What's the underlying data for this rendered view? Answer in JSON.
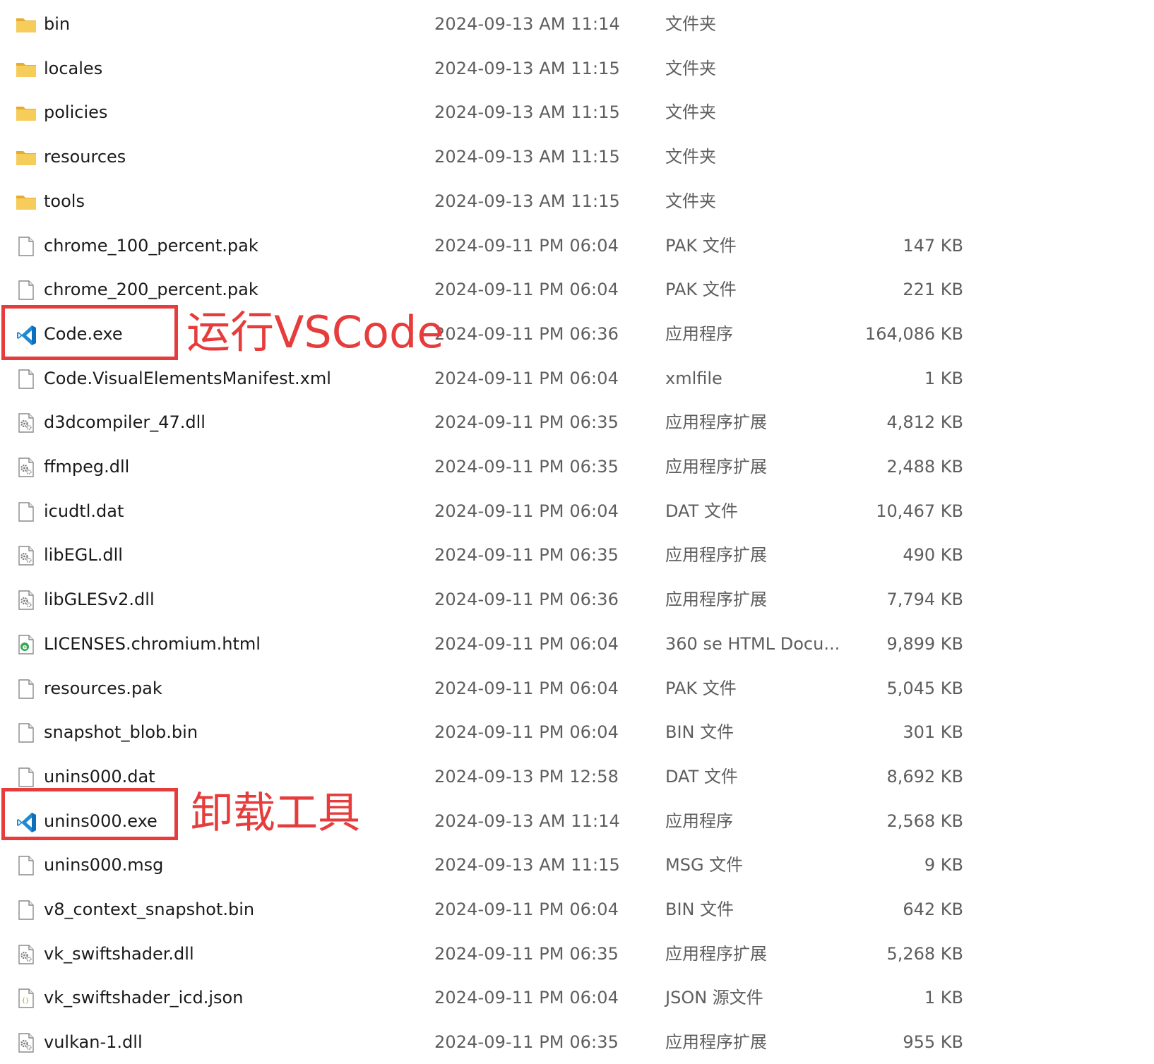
{
  "files": [
    {
      "name": "bin",
      "date": "2024-09-13 AM 11:14",
      "type": "文件夹",
      "size": "",
      "icon": "folder-icon"
    },
    {
      "name": "locales",
      "date": "2024-09-13 AM 11:15",
      "type": "文件夹",
      "size": "",
      "icon": "folder-icon"
    },
    {
      "name": "policies",
      "date": "2024-09-13 AM 11:15",
      "type": "文件夹",
      "size": "",
      "icon": "folder-icon"
    },
    {
      "name": "resources",
      "date": "2024-09-13 AM 11:15",
      "type": "文件夹",
      "size": "",
      "icon": "folder-icon"
    },
    {
      "name": "tools",
      "date": "2024-09-13 AM 11:15",
      "type": "文件夹",
      "size": "",
      "icon": "folder-icon"
    },
    {
      "name": "chrome_100_percent.pak",
      "date": "2024-09-11 PM 06:04",
      "type": "PAK 文件",
      "size": "147 KB",
      "icon": "file-icon"
    },
    {
      "name": "chrome_200_percent.pak",
      "date": "2024-09-11 PM 06:04",
      "type": "PAK 文件",
      "size": "221 KB",
      "icon": "file-icon"
    },
    {
      "name": "Code.exe",
      "date": "2024-09-11 PM 06:36",
      "type": "应用程序",
      "size": "164,086 KB",
      "icon": "vscode-icon"
    },
    {
      "name": "Code.VisualElementsManifest.xml",
      "date": "2024-09-11 PM 06:04",
      "type": "xmlfile",
      "size": "1 KB",
      "icon": "file-icon"
    },
    {
      "name": "d3dcompiler_47.dll",
      "date": "2024-09-11 PM 06:35",
      "type": "应用程序扩展",
      "size": "4,812 KB",
      "icon": "dll-icon"
    },
    {
      "name": "ffmpeg.dll",
      "date": "2024-09-11 PM 06:35",
      "type": "应用程序扩展",
      "size": "2,488 KB",
      "icon": "dll-icon"
    },
    {
      "name": "icudtl.dat",
      "date": "2024-09-11 PM 06:04",
      "type": "DAT 文件",
      "size": "10,467 KB",
      "icon": "file-icon"
    },
    {
      "name": "libEGL.dll",
      "date": "2024-09-11 PM 06:35",
      "type": "应用程序扩展",
      "size": "490 KB",
      "icon": "dll-icon"
    },
    {
      "name": "libGLESv2.dll",
      "date": "2024-09-11 PM 06:36",
      "type": "应用程序扩展",
      "size": "7,794 KB",
      "icon": "dll-icon"
    },
    {
      "name": "LICENSES.chromium.html",
      "date": "2024-09-11 PM 06:04",
      "type": "360 se HTML Docu...",
      "size": "9,899 KB",
      "icon": "html-icon"
    },
    {
      "name": "resources.pak",
      "date": "2024-09-11 PM 06:04",
      "type": "PAK 文件",
      "size": "5,045 KB",
      "icon": "file-icon"
    },
    {
      "name": "snapshot_blob.bin",
      "date": "2024-09-11 PM 06:04",
      "type": "BIN 文件",
      "size": "301 KB",
      "icon": "file-icon"
    },
    {
      "name": "unins000.dat",
      "date": "2024-09-13 PM 12:58",
      "type": "DAT 文件",
      "size": "8,692 KB",
      "icon": "file-icon"
    },
    {
      "name": "unins000.exe",
      "date": "2024-09-13 AM 11:14",
      "type": "应用程序",
      "size": "2,568 KB",
      "icon": "vscode-icon"
    },
    {
      "name": "unins000.msg",
      "date": "2024-09-13 AM 11:15",
      "type": "MSG 文件",
      "size": "9 KB",
      "icon": "file-icon"
    },
    {
      "name": "v8_context_snapshot.bin",
      "date": "2024-09-11 PM 06:04",
      "type": "BIN 文件",
      "size": "642 KB",
      "icon": "file-icon"
    },
    {
      "name": "vk_swiftshader.dll",
      "date": "2024-09-11 PM 06:35",
      "type": "应用程序扩展",
      "size": "5,268 KB",
      "icon": "dll-icon"
    },
    {
      "name": "vk_swiftshader_icd.json",
      "date": "2024-09-11 PM 06:04",
      "type": "JSON 源文件",
      "size": "1 KB",
      "icon": "json-icon"
    },
    {
      "name": "vulkan-1.dll",
      "date": "2024-09-11 PM 06:35",
      "type": "应用程序扩展",
      "size": "955 KB",
      "icon": "dll-icon"
    }
  ],
  "annotations": {
    "run_label": "运行VSCode",
    "uninstall_label": "卸载工具"
  },
  "colors": {
    "annotation": "#e63c3c",
    "folder": "#f2c14e",
    "vscode": "#1f8ad2"
  }
}
